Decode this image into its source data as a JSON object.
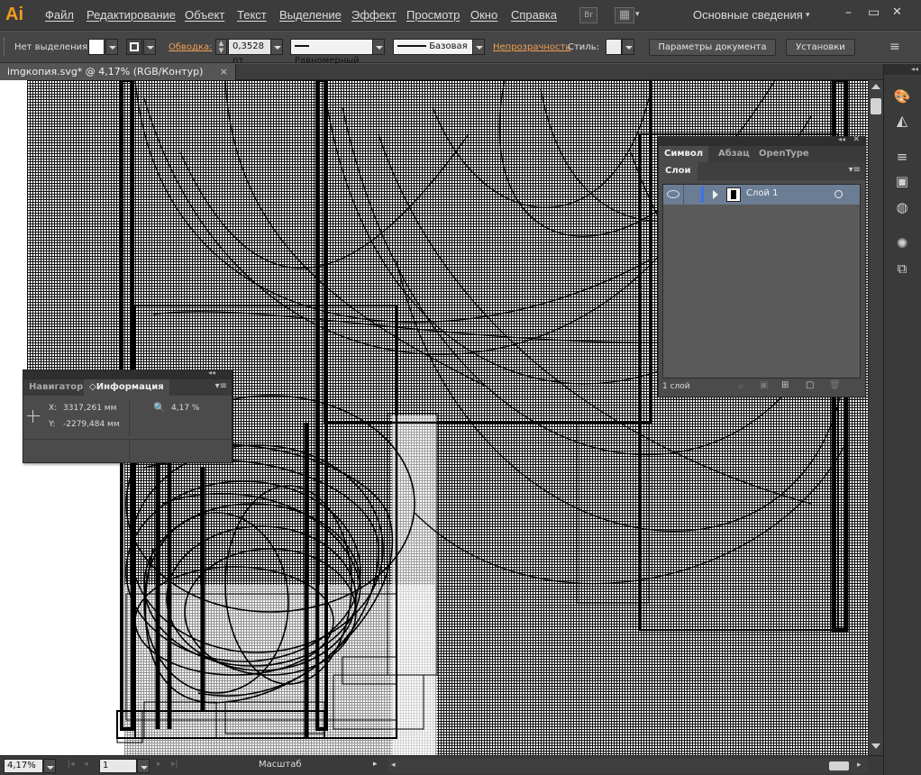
{
  "app": {
    "logo": "Ai"
  },
  "menu": [
    "Файл",
    "Редактирование",
    "Объект",
    "Текст",
    "Выделение",
    "Эффект",
    "Просмотр",
    "Окно",
    "Справка"
  ],
  "menu_buttons": {
    "bridge": "Br",
    "arrange": "▦"
  },
  "workspace": {
    "label": "Основные сведения",
    "arrow": "▾"
  },
  "window_controls": {
    "minimize": "–",
    "restore": "▭",
    "close": "✕"
  },
  "control_bar": {
    "selection": "Нет выделения",
    "stroke_label": "Обводка:",
    "stroke_value": "0,3528 пт",
    "profile": "Равномерный",
    "brush": "Базовая",
    "opacity_label": "Непрозрачность",
    "style_label": "Стиль:",
    "doc_settings": "Параметры документа",
    "preferences": "Установки",
    "menu_icon": "≡"
  },
  "document_tab": {
    "title": "imgкопия.svg* @ 4,17% (RGB/Контур)",
    "close": "×"
  },
  "layers_panel": {
    "tabs": [
      "Символ",
      "Абзац",
      "OpenType"
    ],
    "subtab": "Слои",
    "layer_name": "Слой 1",
    "layer_count": "1 слой",
    "collapse": "◂◂",
    "close": "✕",
    "menu": "▾≡"
  },
  "info_panel": {
    "tabs": [
      "Навигатор",
      "Информация"
    ],
    "x_label": "X:",
    "x_value": "3317,261 мм",
    "y_label": "Y:",
    "y_value": "-2279,484 мм",
    "zoom_value": "4,17 %",
    "collapse": "◂◂",
    "menu": "▾≡"
  },
  "status_bar": {
    "zoom": "4,17%",
    "artboard": "1",
    "tool_label": "Масштаб"
  },
  "icons": {
    "crosshair": "crosshair-icon",
    "zoom": "zoom-icon",
    "eye": "eye-icon",
    "color": "color-palette-icon",
    "gradient": "gradient-icon"
  }
}
